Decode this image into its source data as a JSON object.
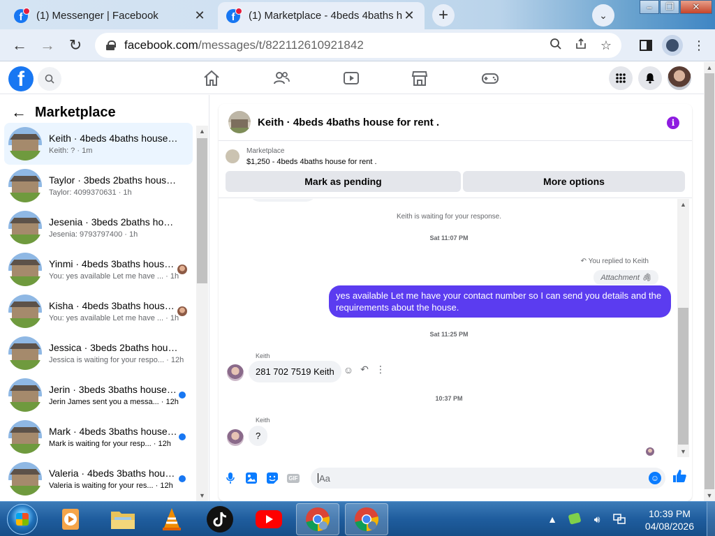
{
  "browser": {
    "tabs": [
      {
        "title": "(1) Messenger | Facebook",
        "active": false
      },
      {
        "title": "(1) Marketplace - 4beds 4baths h",
        "active": true
      }
    ],
    "url_host": "facebook.com",
    "url_path": "/messages/t/822112610921842"
  },
  "marketplace": {
    "title": "Marketplace",
    "conversations": [
      {
        "name": "Keith · 4beds 4baths house for ...",
        "snippet": "Keith: ? · 1m",
        "active": true,
        "unread": false,
        "indicator": "none"
      },
      {
        "name": "Taylor · 3beds 2baths house fo...",
        "snippet": "Taylor: 4099370631 · 1h",
        "active": false,
        "unread": false,
        "indicator": "none"
      },
      {
        "name": "Jesenia · 3beds 2baths house f...",
        "snippet": "Jesenia: 9793797400 · 1h",
        "active": false,
        "unread": false,
        "indicator": "none"
      },
      {
        "name": "Yinmi · 4beds 3baths house ...",
        "snippet": "You: yes available Let me have ... · 1h",
        "active": false,
        "unread": false,
        "indicator": "seen"
      },
      {
        "name": "Kisha · 4beds 3baths house f...",
        "snippet": "You: yes available Let me have ... · 1h",
        "active": false,
        "unread": false,
        "indicator": "seen"
      },
      {
        "name": "Jessica · 3beds 2baths house f...",
        "snippet": "Jessica is waiting for your respo... · 12h",
        "active": false,
        "unread": false,
        "indicator": "none"
      },
      {
        "name": "Jerin · 3beds 3baths house fo...",
        "snippet": "Jerin James sent you a messa... · 12h",
        "active": false,
        "unread": true,
        "indicator": "dot"
      },
      {
        "name": "Mark · 4beds 3baths house f...",
        "snippet": "Mark is waiting for your resp... · 12h",
        "active": false,
        "unread": true,
        "indicator": "dot"
      },
      {
        "name": "Valeria · 4beds 3baths house ...",
        "snippet": "Valeria is waiting for your res... · 12h",
        "active": false,
        "unread": true,
        "indicator": "dot"
      }
    ]
  },
  "chat": {
    "title": "Keith · 4beds 4baths house for rent .",
    "listing_label": "Marketplace",
    "listing_price": "$1,250 - 4beds 4baths house for rent .",
    "mark_pending": "Mark as pending",
    "more_options": "More options",
    "waiting_text": "Keith is waiting for your response.",
    "time1": "Sat 11:07 PM",
    "replied_text": "You replied to Keith",
    "attachment_text": "Attachment",
    "outgoing_message": "yes available Let me have your contact number so I can send you details and the requirements about the house.",
    "time2": "Sat 11:25 PM",
    "sender_name": "Keith",
    "incoming1": "281 702 7519 Keith",
    "time3": "10:37 PM",
    "sender_name2": "Keith",
    "incoming2": "?",
    "input_placeholder": "Aa"
  },
  "taskbar": {
    "time": "10:39 PM",
    "date": "04/08/2026"
  },
  "colors": {
    "fb_blue": "#1877f2",
    "outgoing_bubble": "#5b3cf0",
    "info_purple": "#8e1be0"
  }
}
